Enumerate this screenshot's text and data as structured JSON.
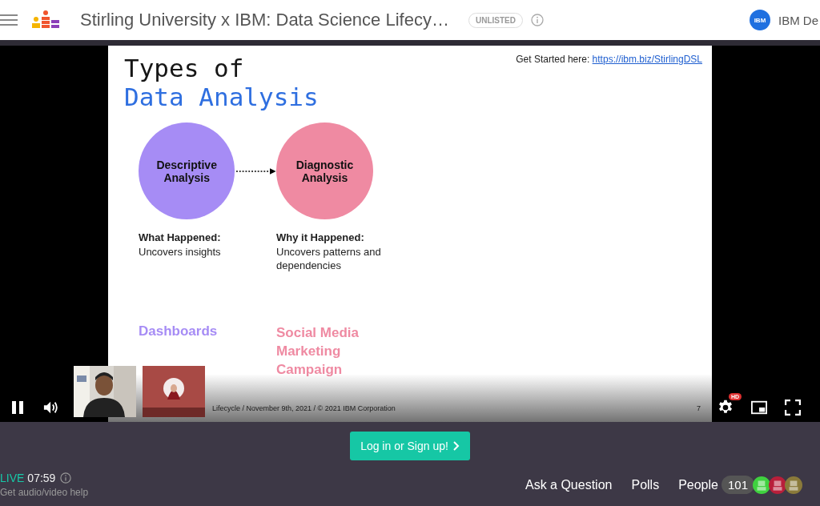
{
  "header": {
    "title": "Stirling University x IBM: Data Science Lifecy…",
    "badge": "UNLISTED",
    "channel": {
      "logo": "IBM",
      "name": "IBM De"
    }
  },
  "slide": {
    "title_line1": "Types of",
    "title_line2": "Data Analysis",
    "link_label": "Get Started here:",
    "link": "https://ibm.biz/StirlingDSL",
    "stages": [
      {
        "name": "Descriptive Analysis",
        "color": "#a68cf5",
        "heading": "What Happened:",
        "text": "Uncovers insights",
        "example": "Dashboards"
      },
      {
        "name": "Diagnostic Analysis",
        "color": "#ef8aa2",
        "heading": "Why it Happened:",
        "text": "Uncovers patterns and dependencies",
        "example": "Social Media Marketing Campaign"
      }
    ],
    "footer": "Lifecycle / November 9th, 2021 / © 2021 IBM Corporation",
    "page": "7"
  },
  "player": {
    "playing": true,
    "hd": "HD"
  },
  "login_button": "Log in or Sign up!",
  "status": {
    "live": "LIVE",
    "time": "07:59",
    "help": "Get audio/video help"
  },
  "nav": [
    {
      "label": "Ask a Question"
    },
    {
      "label": "Polls"
    },
    {
      "label": "People",
      "count": "101"
    }
  ],
  "avatars": [
    {
      "color": "#3fd13f"
    },
    {
      "color": "#b81f3a"
    },
    {
      "color": "#8a7a3a"
    }
  ]
}
